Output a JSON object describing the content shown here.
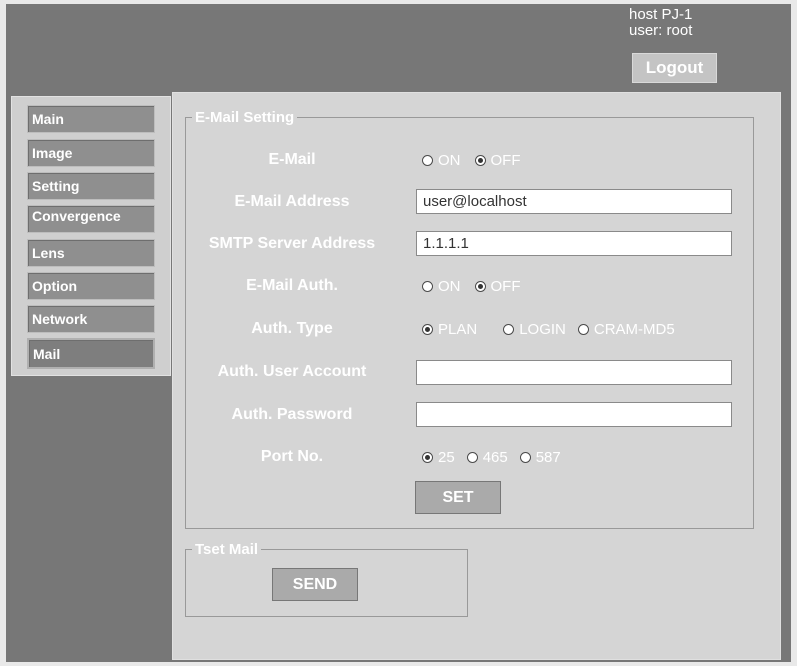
{
  "header": {
    "host": "host PJ-1",
    "user": "user: root",
    "logout_label": "Logout"
  },
  "sidebar": {
    "items": [
      {
        "label": "Main",
        "active": false
      },
      {
        "label": "Image",
        "active": false
      },
      {
        "label": "Setting",
        "active": false
      },
      {
        "label": "Convergence",
        "active": false
      },
      {
        "label": "Lens",
        "active": false
      },
      {
        "label": "Option",
        "active": false
      },
      {
        "label": "Network",
        "active": false
      },
      {
        "label": "Mail",
        "active": true
      }
    ]
  },
  "email_setting": {
    "legend": "E-Mail Setting",
    "email": {
      "label": "E-Mail",
      "options": [
        {
          "label": "ON",
          "checked": false
        },
        {
          "label": "OFF",
          "checked": true
        }
      ]
    },
    "email_address": {
      "label": "E-Mail Address",
      "value": "user@localhost"
    },
    "smtp_server": {
      "label": "SMTP Server Address",
      "value": "1.1.1.1"
    },
    "email_auth": {
      "label": "E-Mail Auth.",
      "options": [
        {
          "label": "ON",
          "checked": false
        },
        {
          "label": "OFF",
          "checked": true
        }
      ]
    },
    "auth_type": {
      "label": "Auth. Type",
      "options": [
        {
          "label": "PLAN",
          "checked": true
        },
        {
          "label": "LOGIN",
          "checked": false
        },
        {
          "label": "CRAM-MD5",
          "checked": false
        }
      ]
    },
    "auth_user": {
      "label": "Auth. User Account",
      "value": ""
    },
    "auth_password": {
      "label": "Auth. Password",
      "value": ""
    },
    "port": {
      "label": "Port No.",
      "options": [
        {
          "label": "25",
          "checked": true
        },
        {
          "label": "465",
          "checked": false
        },
        {
          "label": "587",
          "checked": false
        }
      ]
    },
    "set_label": "SET"
  },
  "test_mail": {
    "legend": "Tset Mail",
    "send_label": "SEND"
  },
  "colors": {
    "background": "#777777",
    "panel": "#d5d5d5",
    "nav_button": "#8f8f8f",
    "text": "#ffffff"
  }
}
